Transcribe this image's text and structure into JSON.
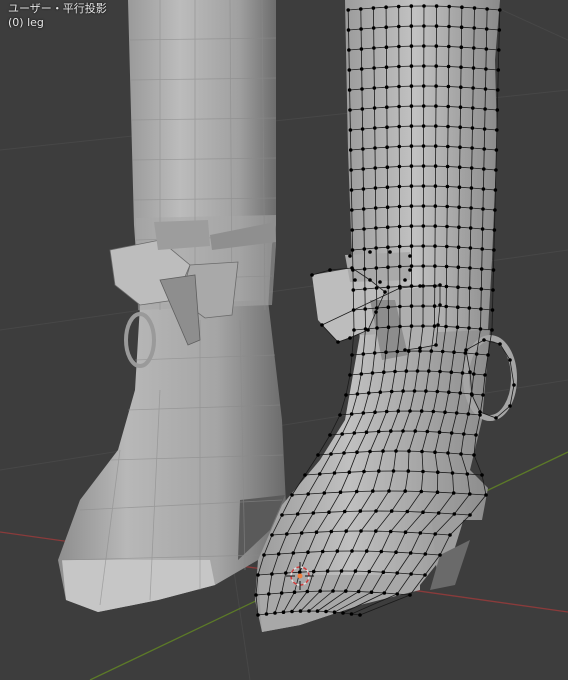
{
  "viewport": {
    "view_label": "ユーザー・平行投影",
    "object_label": "(0) leg",
    "colors": {
      "background": "#3d3d3d",
      "grid_line": "#474747",
      "x_axis": "#8a3b3b",
      "y_axis": "#5c7a28",
      "mesh_light": "#b5b5b5",
      "mesh_mid": "#959595",
      "mesh_dark": "#5e5e5e",
      "wire": "#000000",
      "vertex": "#000000",
      "cursor_ring": "#e0e0e0",
      "cursor_center": "#f08040"
    }
  },
  "objects": [
    {
      "name": "left-boot",
      "mode": "object"
    },
    {
      "name": "right-boot",
      "mode": "edit-wireframe"
    }
  ],
  "cursor": {
    "name": "3d-cursor"
  }
}
